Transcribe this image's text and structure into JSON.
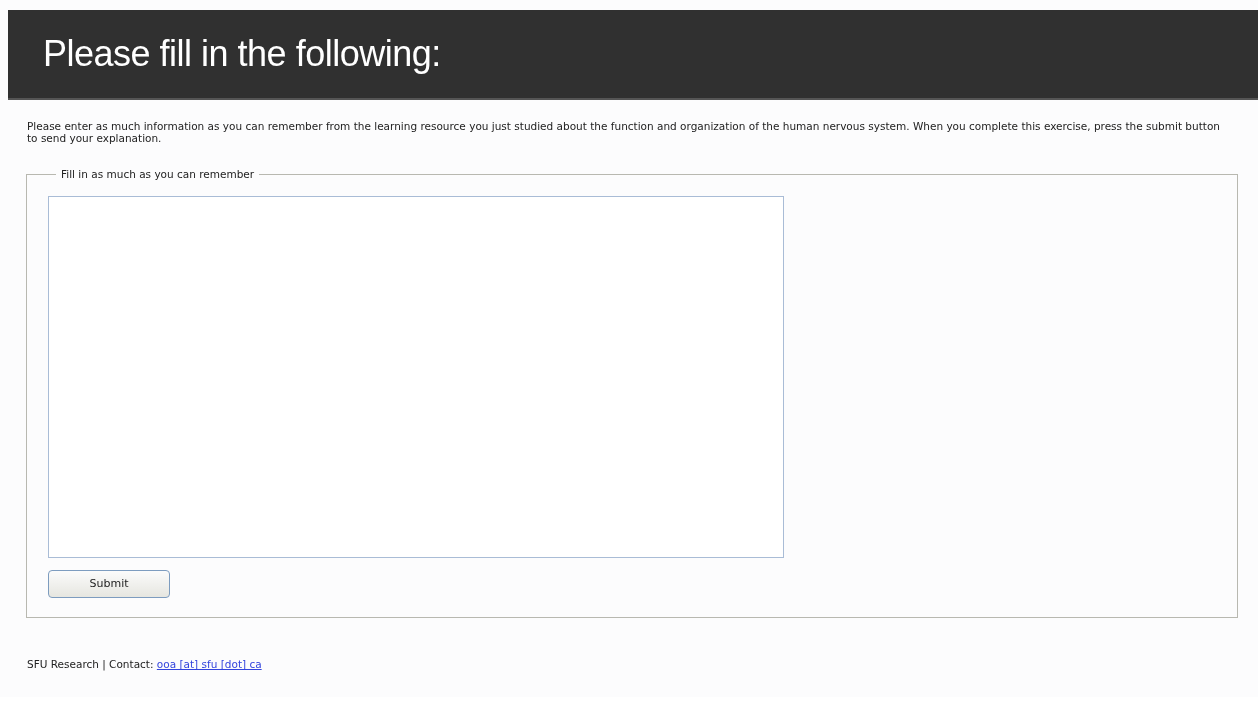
{
  "header": {
    "title": "Please fill in the following:"
  },
  "intro": "Please enter as much information as you can remember from the learning resource you just studied about the function and organization of the human nervous system. When you complete this exercise, press the submit button to send your explanation.",
  "form": {
    "legend": "Fill in as much as you can remember",
    "submit": "Submit"
  },
  "footer": {
    "text": "SFU Research | Contact:",
    "link": "ooa [at] sfu [dot] ca"
  }
}
